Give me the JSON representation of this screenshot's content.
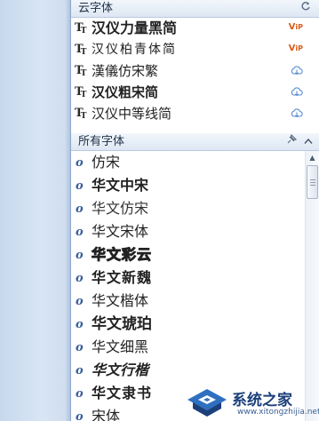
{
  "cloud_fonts": {
    "header": "云字体",
    "refresh_icon": "refresh-icon",
    "items": [
      {
        "name": "汉仪力量黑简",
        "badge": "VIP"
      },
      {
        "name": "汉仪柏青体简",
        "badge": "VIP"
      },
      {
        "name": "漢儀仿宋繁",
        "badge": "download"
      },
      {
        "name": "汉仪粗宋简",
        "badge": "download"
      },
      {
        "name": "汉仪中等线简",
        "badge": "download"
      }
    ]
  },
  "all_fonts": {
    "header": "所有字体",
    "items": [
      {
        "name": "仿宋"
      },
      {
        "name": "华文中宋"
      },
      {
        "name": "华文仿宋"
      },
      {
        "name": "华文宋体"
      },
      {
        "name": "华文彩云"
      },
      {
        "name": "华文新魏"
      },
      {
        "name": "华文楷体"
      },
      {
        "name": "华文琥珀"
      },
      {
        "name": "华文细黑"
      },
      {
        "name": "华文行楷"
      },
      {
        "name": "华文隶书"
      },
      {
        "name": "宋体"
      }
    ]
  },
  "watermark": {
    "brand": "系统之家",
    "url": "www.xitongzhijia.net"
  },
  "colors": {
    "vip": "#d95b1a",
    "download": "#5b8fd1",
    "accent": "#3a5f9a"
  }
}
